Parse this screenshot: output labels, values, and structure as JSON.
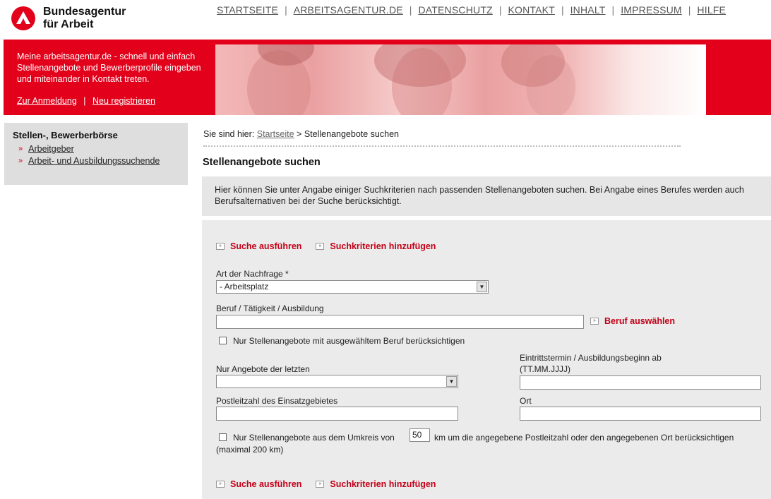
{
  "header": {
    "logo_line1": "Bundesagentur",
    "logo_line2": "für Arbeit",
    "nav": [
      "STARTSEITE",
      "ARBEITSAGENTUR.DE",
      "DATENSCHUTZ",
      "KONTAKT",
      "INHALT",
      "IMPRESSUM",
      "HILFE"
    ],
    "nav_sep": "|"
  },
  "banner": {
    "text": "Meine arbeitsagentur.de - schnell und einfach Stellenangebote und Bewerberprofile eingeben und miteinander in Kontakt treten.",
    "login_link": "Zur Anmeldung",
    "register_link": "Neu registrieren",
    "sep": "|"
  },
  "sidebar": {
    "title": "Stellen-, Bewerberbörse",
    "items": [
      "Arbeitgeber",
      "Arbeit- und Ausbildungssuchende"
    ],
    "bullet": "»"
  },
  "breadcrumb": {
    "prefix": "Sie sind hier:",
    "home": "Startseite",
    "separator": ">",
    "current": "Stellenangebote suchen"
  },
  "page": {
    "title": "Stellenangebote suchen",
    "info": "Hier können Sie unter Angabe einiger Suchkriterien nach passenden Stellenangeboten suchen. Bei Angabe eines Berufes werden auch Berufsalternativen bei der Suche berücksichtigt."
  },
  "form": {
    "search_label": "Suche ausführen",
    "add_criteria_label": "Suchkriterien hinzufügen",
    "action_icon": "»",
    "art_label": "Art der Nachfrage *",
    "art_value": "- Arbeitsplatz",
    "beruf_label": "Beruf / Tätigkeit / Ausbildung",
    "beruf_value": "",
    "beruf_select_label": "Beruf auswählen",
    "only_selected_label": "Nur Stellenangebote mit ausgewähltem Beruf berücksichtigen",
    "only_selected_checked": false,
    "recent_label": "Nur Angebote der letzten",
    "recent_value": "",
    "eintritt_label_line1": "Eintrittstermin / Ausbildungsbeginn ab",
    "eintritt_label_line2": "(TT.MM.JJJJ)",
    "eintritt_value": "",
    "plz_label": "Postleitzahl des Einsatzgebietes",
    "plz_value": "",
    "ort_label": "Ort",
    "ort_value": "",
    "umkreis_prefix": "Nur Stellenangebote aus dem Umkreis von",
    "umkreis_value": "50",
    "umkreis_suffix": "km um die angegebene Postleitzahl oder den angegebenen Ort berücksichtigen",
    "umkreis_note": "(maximal 200 km)",
    "umkreis_checked": false,
    "dropdown_arrow": "▼"
  },
  "colors": {
    "brand_red": "#e2001a",
    "action_red": "#c40017",
    "panel_gray": "#ebebeb"
  }
}
